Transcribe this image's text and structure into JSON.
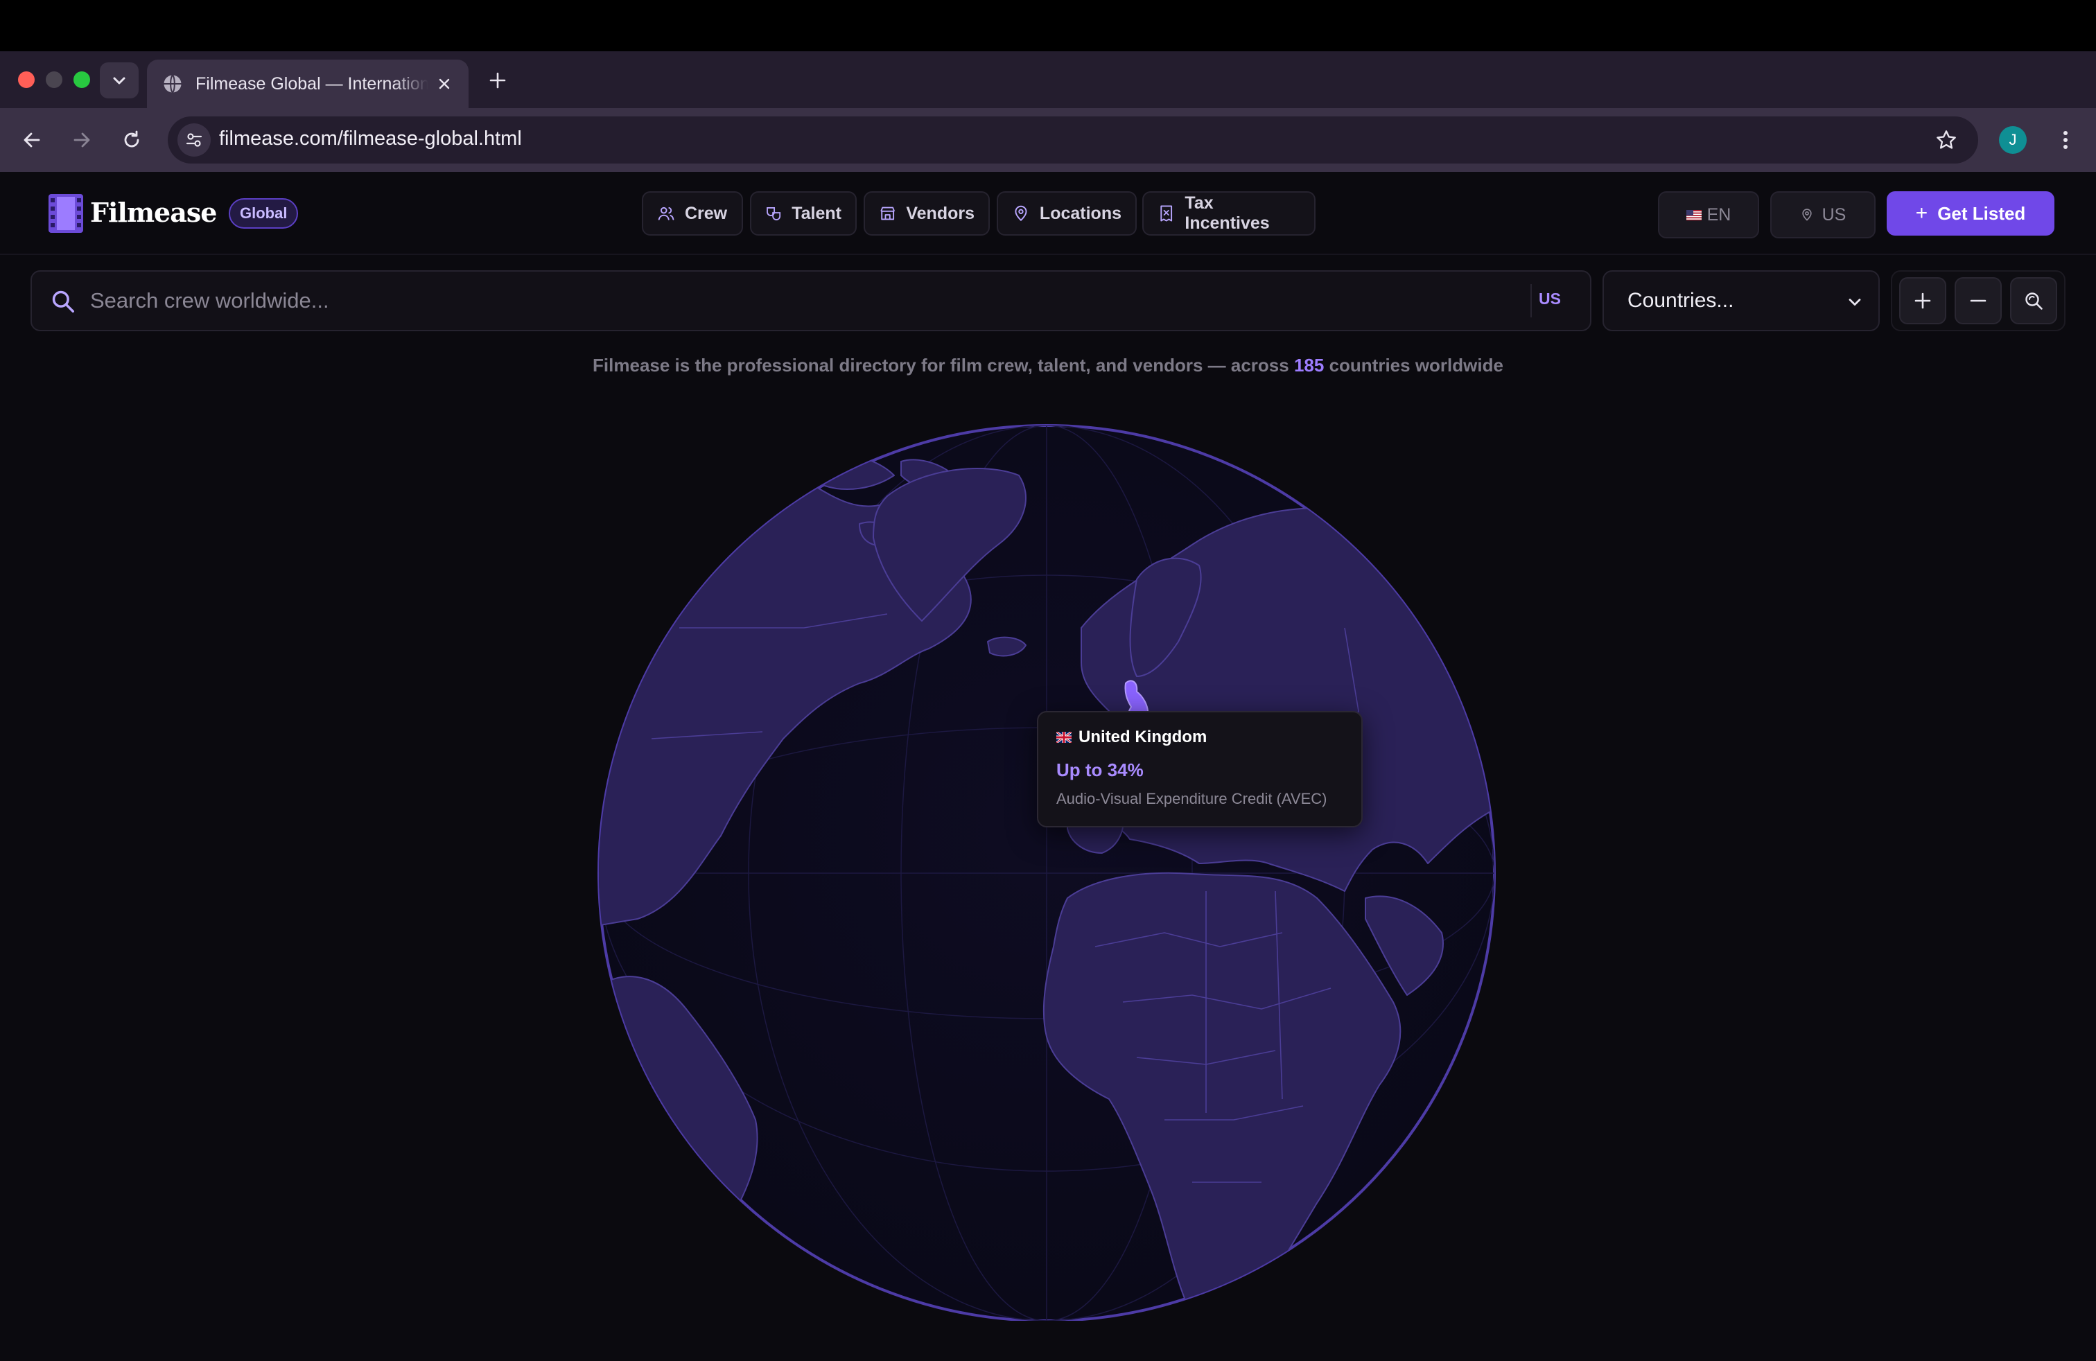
{
  "browser": {
    "tab_title": "Filmease Global — International Film Directory",
    "url": "filmease.com/filmease-global.html",
    "profile_initial": "J"
  },
  "header": {
    "logo_text": "Filmease",
    "badge": "Global",
    "nav": [
      {
        "label": "Crew",
        "icon": "users-icon"
      },
      {
        "label": "Talent",
        "icon": "masks-icon"
      },
      {
        "label": "Vendors",
        "icon": "store-icon"
      },
      {
        "label": "Locations",
        "icon": "map-pin-icon"
      },
      {
        "label": "Tax Incentives",
        "icon": "receipt-icon"
      }
    ],
    "language": {
      "flag": "us-flag-icon",
      "label": "EN"
    },
    "region": {
      "label": "US"
    },
    "cta_label": "Get Listed"
  },
  "search": {
    "placeholder": "Search crew worldwide...",
    "region_tag": "US",
    "country_select": "Countries..."
  },
  "tagline": {
    "before": "Filmease is the professional directory for film crew, talent, and vendors — across",
    "count": "185",
    "after": "countries worldwide"
  },
  "map": {
    "highlighted_country": "United Kingdom",
    "accent_color": "#7048e8"
  },
  "tooltip": {
    "country": "United Kingdom",
    "flag": "uk-flag-icon",
    "rate": "Up to 34%",
    "description": "Audio-Visual Expenditure Credit (AVEC)"
  },
  "colors": {
    "background": "#0b0a0f",
    "accent": "#7048e8",
    "accent_text": "#a98bff",
    "land": "#2a2157",
    "ocean": "#0b0a1a"
  }
}
